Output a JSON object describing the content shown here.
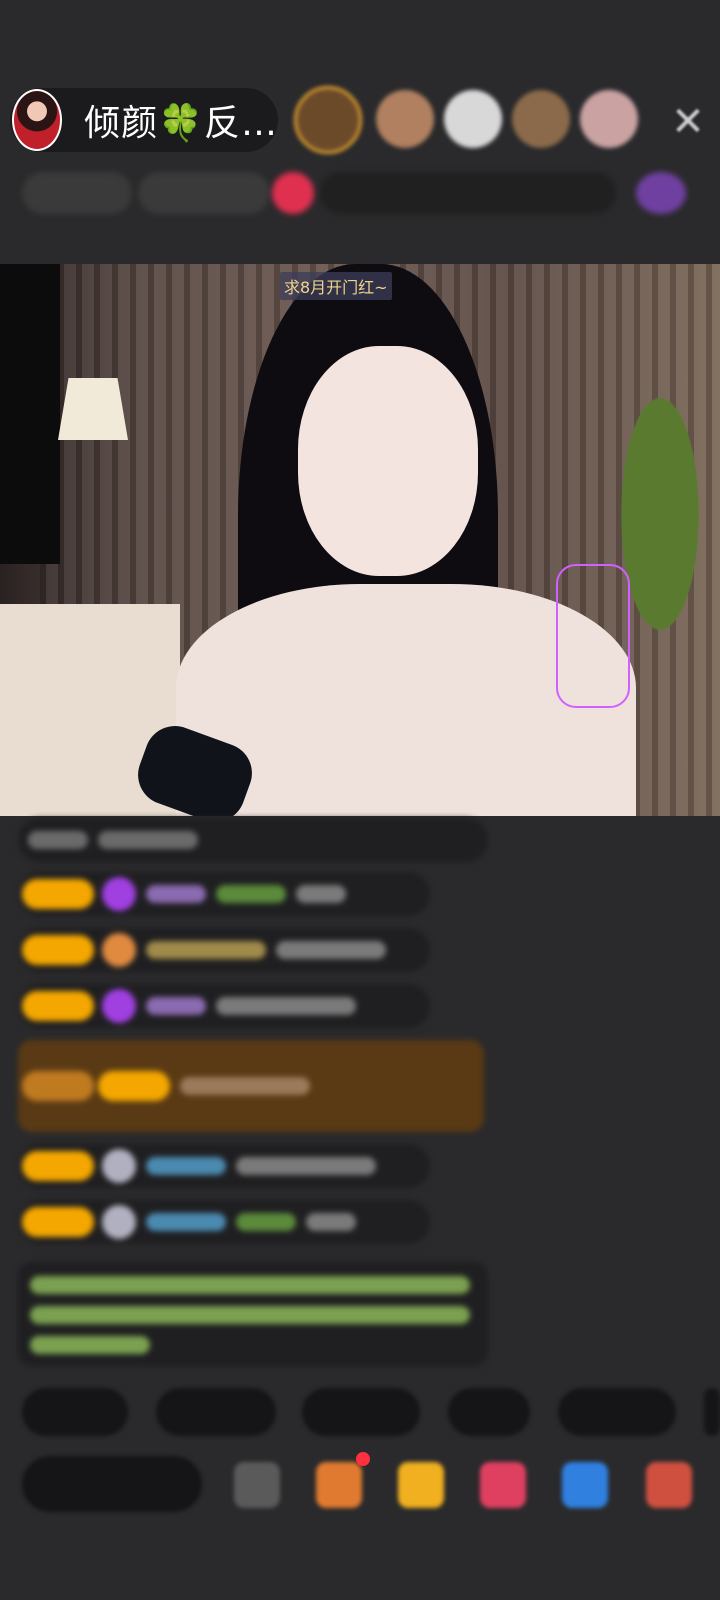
{
  "header": {
    "host_name": "倾颜🍀反…",
    "close_icon": "close-icon"
  },
  "video": {
    "overlay_text": "求8月开门红~"
  },
  "colors": {
    "background": "#2a2a2c",
    "badge": "#f4a700",
    "highlight_chat": "#5a3a14",
    "system_message": "#9bcf6a"
  }
}
